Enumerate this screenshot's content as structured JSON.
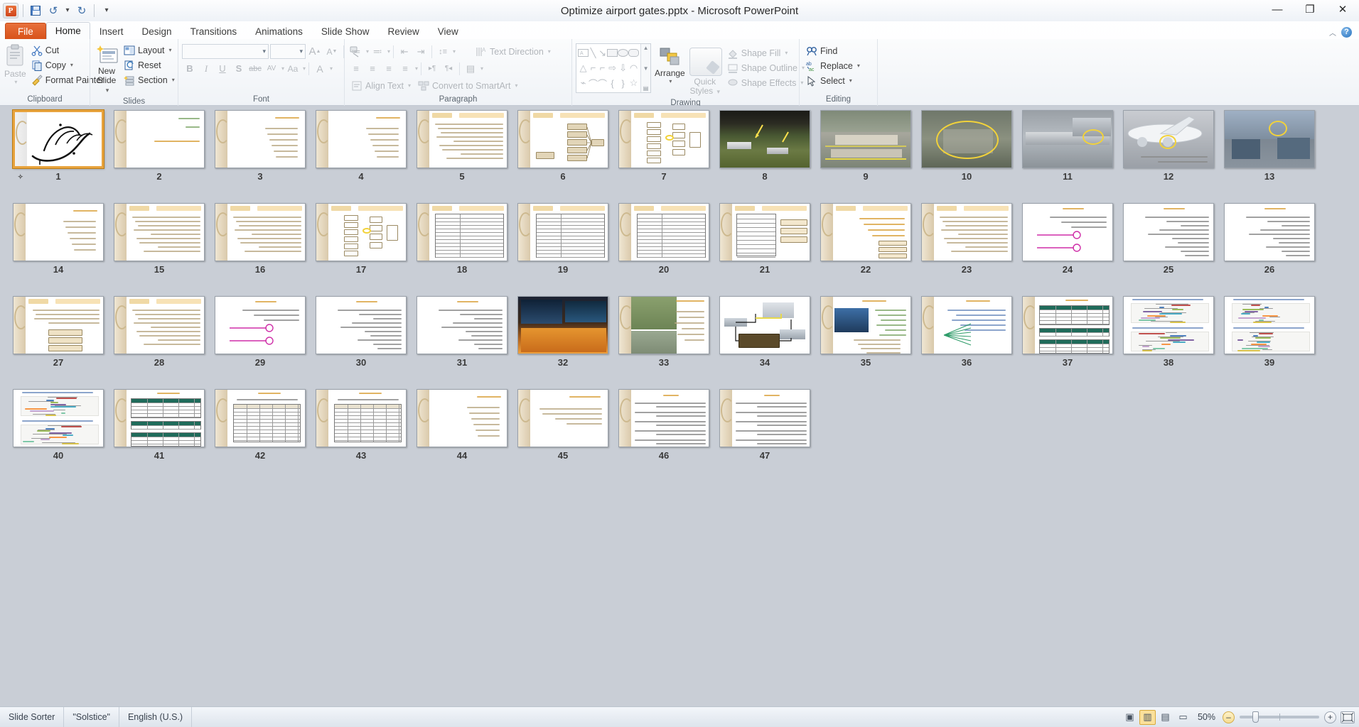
{
  "window": {
    "title": "Optimize airport gates.pptx  -  Microsoft PowerPoint",
    "minimize": "—",
    "restore": "❐",
    "close": "✕"
  },
  "quick_access": {
    "app_logo": "P",
    "save": "save-icon",
    "undo": "↺",
    "undo_caret": "▾",
    "redo": "↻",
    "customize": "▾"
  },
  "help": {
    "collapse_ribbon": "︿",
    "help": "?"
  },
  "tabs": [
    {
      "label": "File",
      "active": false,
      "file": true
    },
    {
      "label": "Home",
      "active": true
    },
    {
      "label": "Insert",
      "active": false
    },
    {
      "label": "Design",
      "active": false
    },
    {
      "label": "Transitions",
      "active": false
    },
    {
      "label": "Animations",
      "active": false
    },
    {
      "label": "Slide Show",
      "active": false
    },
    {
      "label": "Review",
      "active": false
    },
    {
      "label": "View",
      "active": false
    }
  ],
  "ribbon": {
    "clipboard": {
      "label": "Clipboard",
      "paste": "Paste",
      "cut": "Cut",
      "copy": "Copy",
      "format_painter": "Format Painter",
      "dialog_launcher": "⌐"
    },
    "slides": {
      "label": "Slides",
      "new_slide": "New",
      "new_slide2": "Slide",
      "layout": "Layout",
      "reset": "Reset",
      "section": "Section"
    },
    "font": {
      "label": "Font",
      "font_name": "",
      "font_size": "",
      "grow": "A",
      "shrink": "A",
      "clear_formatting": "Aa",
      "bold": "B",
      "italic": "I",
      "underline": "U",
      "shadow": "S",
      "strikethrough": "abc",
      "character_spacing": "AV",
      "change_case": "Aa",
      "font_color": "A",
      "dialog_launcher": "⌐"
    },
    "paragraph": {
      "label": "Paragraph",
      "bullets": "≔",
      "numbering": "≕",
      "decrease_indent": "⇤",
      "increase_indent": "⇥",
      "line_spacing": "↕≡",
      "align_left": "≡",
      "align_center": "≡",
      "align_right": "≡",
      "justify": "≡",
      "ltr": "▸¶",
      "rtl": "¶◂",
      "columns": "▤",
      "text_direction": "Text Direction",
      "align_text": "Align Text",
      "convert_to_smartart": "Convert to SmartArt",
      "dialog_launcher": "⌐"
    },
    "drawing": {
      "label": "Drawing",
      "arrange": "Arrange",
      "quick_styles": "Quick",
      "quick_styles2": "Styles",
      "shape_fill": "Shape Fill",
      "shape_outline": "Shape Outline",
      "shape_effects": "Shape Effects",
      "shapes": [
        "▭A",
        "╲",
        "↘",
        "▢",
        "◯",
        "▭",
        "△",
        "⌐",
        "⌐",
        "⇨",
        "⇩",
        "◠",
        "⌁",
        "⌒",
        "⌒",
        "{",
        "}",
        "☆"
      ],
      "scroll_up": "▲",
      "scroll_down": "▼",
      "scroll_more": "▤",
      "dialog_launcher": "⌐"
    },
    "editing": {
      "label": "Editing",
      "find": "Find",
      "replace": "Replace",
      "select": "Select"
    }
  },
  "status": {
    "view_name": "Slide Sorter",
    "theme": "\"Solstice\"",
    "language": "English (U.S.)",
    "zoom_percent": "50%",
    "view_buttons": [
      {
        "name": "normal-view",
        "glyph": "▣",
        "active": false
      },
      {
        "name": "slide-sorter-view",
        "glyph": "▥",
        "active": true
      },
      {
        "name": "reading-view",
        "glyph": "▤",
        "active": false
      },
      {
        "name": "slide-show-view",
        "glyph": "▭",
        "active": false
      }
    ],
    "zoom_out": "–",
    "zoom_in": "+",
    "fit_to_window": "⛶"
  },
  "sorter": {
    "selected_slide": 1,
    "total_slides": 47,
    "slides": [
      {
        "n": 1,
        "kind": "calligraphy",
        "anim": true
      },
      {
        "n": 2,
        "kind": "title-green"
      },
      {
        "n": 3,
        "kind": "bullets-orange"
      },
      {
        "n": 4,
        "kind": "bullets-orange"
      },
      {
        "n": 5,
        "kind": "text-dense"
      },
      {
        "n": 6,
        "kind": "diagram-tree"
      },
      {
        "n": 7,
        "kind": "flowchart"
      },
      {
        "n": 8,
        "kind": "photo-runway"
      },
      {
        "n": 9,
        "kind": "photo-apron"
      },
      {
        "n": 10,
        "kind": "photo-apron-circle"
      },
      {
        "n": 11,
        "kind": "photo-jetbridge"
      },
      {
        "n": 12,
        "kind": "photo-plane"
      },
      {
        "n": 13,
        "kind": "photo-gate"
      },
      {
        "n": 14,
        "kind": "bullets-orange"
      },
      {
        "n": 15,
        "kind": "text-dense"
      },
      {
        "n": 16,
        "kind": "text-dense"
      },
      {
        "n": 17,
        "kind": "diagram-flow"
      },
      {
        "n": 18,
        "kind": "table2col"
      },
      {
        "n": 19,
        "kind": "table2col"
      },
      {
        "n": 20,
        "kind": "table2col"
      },
      {
        "n": 21,
        "kind": "table-boxes"
      },
      {
        "n": 22,
        "kind": "bullets-box"
      },
      {
        "n": 23,
        "kind": "text-dense"
      },
      {
        "n": 24,
        "kind": "formula-pink"
      },
      {
        "n": 25,
        "kind": "formula"
      },
      {
        "n": 26,
        "kind": "formula"
      },
      {
        "n": 27,
        "kind": "boxes-stack"
      },
      {
        "n": 28,
        "kind": "text-dense"
      },
      {
        "n": 29,
        "kind": "formula-pink"
      },
      {
        "n": 30,
        "kind": "formula"
      },
      {
        "n": 31,
        "kind": "formula"
      },
      {
        "n": 32,
        "kind": "photo-night"
      },
      {
        "n": 33,
        "kind": "photo-aerial-text"
      },
      {
        "n": 34,
        "kind": "diagram-terminal"
      },
      {
        "n": 35,
        "kind": "photo-tower"
      },
      {
        "n": 36,
        "kind": "fan-diagram"
      },
      {
        "n": 37,
        "kind": "table-green"
      },
      {
        "n": 38,
        "kind": "gantt2"
      },
      {
        "n": 39,
        "kind": "gantt2"
      },
      {
        "n": 40,
        "kind": "gantt2"
      },
      {
        "n": 41,
        "kind": "table-green"
      },
      {
        "n": 42,
        "kind": "table-results"
      },
      {
        "n": 43,
        "kind": "table-results"
      },
      {
        "n": 44,
        "kind": "bullets-orange"
      },
      {
        "n": 45,
        "kind": "suggestions"
      },
      {
        "n": 46,
        "kind": "references"
      },
      {
        "n": 47,
        "kind": "references"
      }
    ]
  }
}
